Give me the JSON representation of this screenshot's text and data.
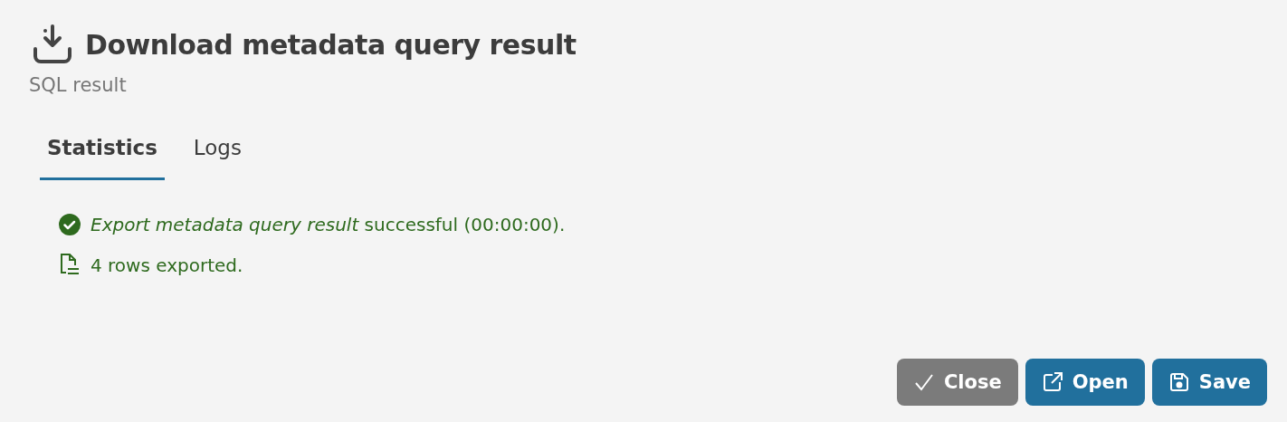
{
  "dialog": {
    "title": "Download metadata query result",
    "subtitle": "SQL result"
  },
  "tabs": [
    {
      "label": "Statistics",
      "selected": true
    },
    {
      "label": "Logs",
      "selected": false
    }
  ],
  "messages": [
    {
      "kind": "success",
      "text": "*Export metadata query result* successful (00:00:00)."
    },
    {
      "kind": "file",
      "text": "4 rows exported."
    }
  ],
  "buttons": [
    {
      "kind": "close",
      "label": "Close"
    },
    {
      "kind": "open",
      "label": "Open"
    },
    {
      "kind": "save",
      "label": "Save"
    }
  ]
}
